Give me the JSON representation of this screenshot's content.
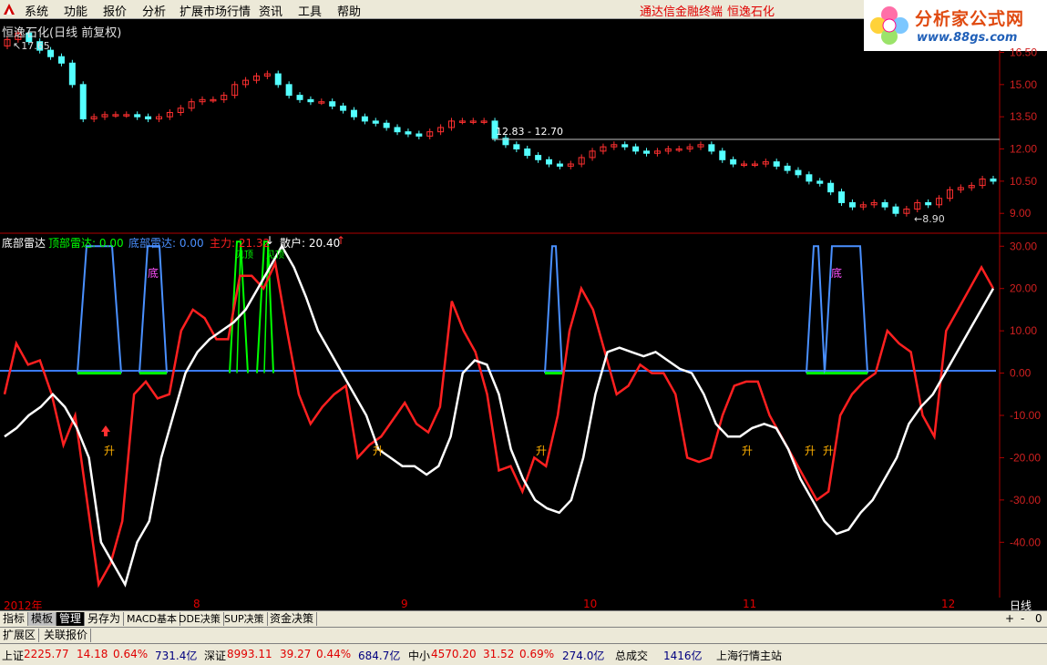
{
  "menu": {
    "items": [
      "系统",
      "功能",
      "报价",
      "分析",
      "扩展市场行情",
      "资讯",
      "工具",
      "帮助"
    ],
    "right_links": [
      "通达信金融终端",
      "恒逸石化"
    ]
  },
  "brand": {
    "name": "分析家公式网",
    "url": "www.88gs.com"
  },
  "main_chart": {
    "title": "恒逸石化(日线 前复权)",
    "high_marker": "17.65",
    "low_marker": "8.90",
    "range_label": "12.83 - 12.70",
    "y_ticks": [
      "16.50",
      "15.00",
      "13.50",
      "12.00",
      "10.50",
      "9.00"
    ]
  },
  "indicator": {
    "name": "底部雷达",
    "legend": [
      {
        "label": "顶部雷达:",
        "value": "0.00",
        "color": "#00ff00"
      },
      {
        "label": "底部雷达:",
        "value": "0.00",
        "color": "#4a90ff"
      },
      {
        "label": "主力:",
        "value": "21.32",
        "color": "#ff2020"
      },
      {
        "label": "散户:",
        "value": "20.40",
        "color": "#ffffff"
      }
    ],
    "y_ticks": [
      "30.00",
      "20.00",
      "10.00",
      "0.00",
      "-10.00",
      "-20.00",
      "-30.00",
      "-40.00"
    ],
    "bottom_text": "底",
    "top_text": "见顶",
    "rise_text": "升"
  },
  "date_axis": {
    "labels": [
      "2012年",
      "8",
      "9",
      "10",
      "11",
      "12"
    ],
    "period": "日线"
  },
  "tabs": [
    "指标",
    "模板",
    "管理",
    "另存为",
    "MACD基本",
    "DDE决策",
    "SUP决策",
    "资金决策"
  ],
  "tabs_right": [
    "+",
    "-",
    "0"
  ],
  "tabs2": [
    "扩展区",
    "关联报价"
  ],
  "status": {
    "sh": {
      "name": "上证",
      "value": "2225.77",
      "change": "14.18",
      "pct": "0.64%",
      "amount": "731.4亿"
    },
    "sz": {
      "name": "深证",
      "value": "8993.11",
      "change": "39.27",
      "pct": "0.44%",
      "amount": "684.7亿"
    },
    "zx": {
      "name": "中小",
      "value": "4570.20",
      "change": "31.52",
      "pct": "0.69%",
      "amount": "274.0亿"
    },
    "total_label": "总成交",
    "total_value": "1416亿",
    "server": "上海行情主站"
  },
  "colors": {
    "up": "#ff3030",
    "down": "#54ffff",
    "main_line": "#ff2020",
    "retail_line": "#ffffff",
    "radar_bottom": "#4a90ff",
    "radar_top": "#00ff00",
    "axis": "#b00000"
  },
  "chart_data": [
    {
      "type": "candlestick",
      "title": "恒逸石化(日线 前复权)",
      "ylim": [
        8.5,
        17.2
      ],
      "candles_close_approx": [
        17.1,
        17.4,
        17.0,
        16.6,
        16.3,
        16.0,
        15.0,
        13.4,
        13.5,
        13.6,
        13.6,
        13.6,
        13.5,
        13.4,
        13.5,
        13.7,
        13.9,
        14.2,
        14.3,
        14.3,
        14.5,
        15.0,
        15.2,
        15.4,
        15.5,
        15.0,
        14.5,
        14.3,
        14.2,
        14.2,
        14.0,
        13.8,
        13.5,
        13.3,
        13.2,
        13.0,
        12.8,
        12.7,
        12.6,
        12.8,
        13.0,
        13.3,
        13.3,
        13.3,
        13.3,
        12.5,
        12.2,
        12.0,
        11.7,
        11.5,
        11.3,
        11.2,
        11.3,
        11.6,
        11.9,
        12.1,
        12.2,
        12.1,
        11.9,
        11.8,
        11.9,
        12.0,
        12.0,
        12.1,
        12.2,
        11.9,
        11.5,
        11.3,
        11.3,
        11.3,
        11.4,
        11.2,
        11.0,
        10.8,
        10.5,
        10.4,
        10.0,
        9.5,
        9.3,
        9.4,
        9.5,
        9.3,
        9.0,
        9.2,
        9.5,
        9.4,
        9.7,
        10.1,
        10.2,
        10.3,
        10.6,
        10.5
      ]
    },
    {
      "type": "line",
      "title": "底部雷达",
      "ylim": [
        -52,
        32
      ],
      "series": [
        {
          "name": "主力",
          "values_approx": [
            -5,
            7,
            2,
            3,
            -5,
            -17,
            -10,
            -30,
            -50,
            -45,
            -35,
            -5,
            -2,
            -6,
            -5,
            10,
            15,
            13,
            8,
            8,
            23,
            23,
            20,
            26,
            10,
            -5,
            -12,
            -8,
            -5,
            -3,
            -20,
            -17,
            -15,
            -11,
            -7,
            -12,
            -14,
            -8,
            17,
            10,
            5,
            -5,
            -23,
            -22,
            -28,
            -20,
            -22,
            -10,
            10,
            20,
            15,
            5,
            -5,
            -3,
            2,
            0,
            0,
            -5,
            -20,
            -21,
            -20,
            -10,
            -3,
            -2,
            -2,
            -10,
            -15,
            -20,
            -25,
            -30,
            -28,
            -10,
            -5,
            -2,
            0,
            10,
            7,
            5,
            -10,
            -15,
            10,
            15,
            20,
            25,
            20
          ]
        },
        {
          "name": "散户",
          "values_approx": [
            -15,
            -13,
            -10,
            -8,
            -5,
            -8,
            -13,
            -20,
            -40,
            -45,
            -50,
            -40,
            -35,
            -20,
            -10,
            0,
            5,
            8,
            10,
            12,
            15,
            20,
            25,
            30,
            25,
            18,
            10,
            5,
            0,
            -5,
            -10,
            -18,
            -20,
            -22,
            -22,
            -24,
            -22,
            -15,
            0,
            3,
            2,
            -5,
            -18,
            -25,
            -30,
            -32,
            -33,
            -30,
            -20,
            -5,
            5,
            6,
            5,
            4,
            5,
            3,
            1,
            0,
            -5,
            -12,
            -15,
            -15,
            -13,
            -12,
            -13,
            -18,
            -25,
            -30,
            -35,
            -38,
            -37,
            -33,
            -30,
            -25,
            -20,
            -12,
            -8,
            -5,
            0,
            5,
            10,
            15,
            20
          ]
        }
      ]
    }
  ]
}
